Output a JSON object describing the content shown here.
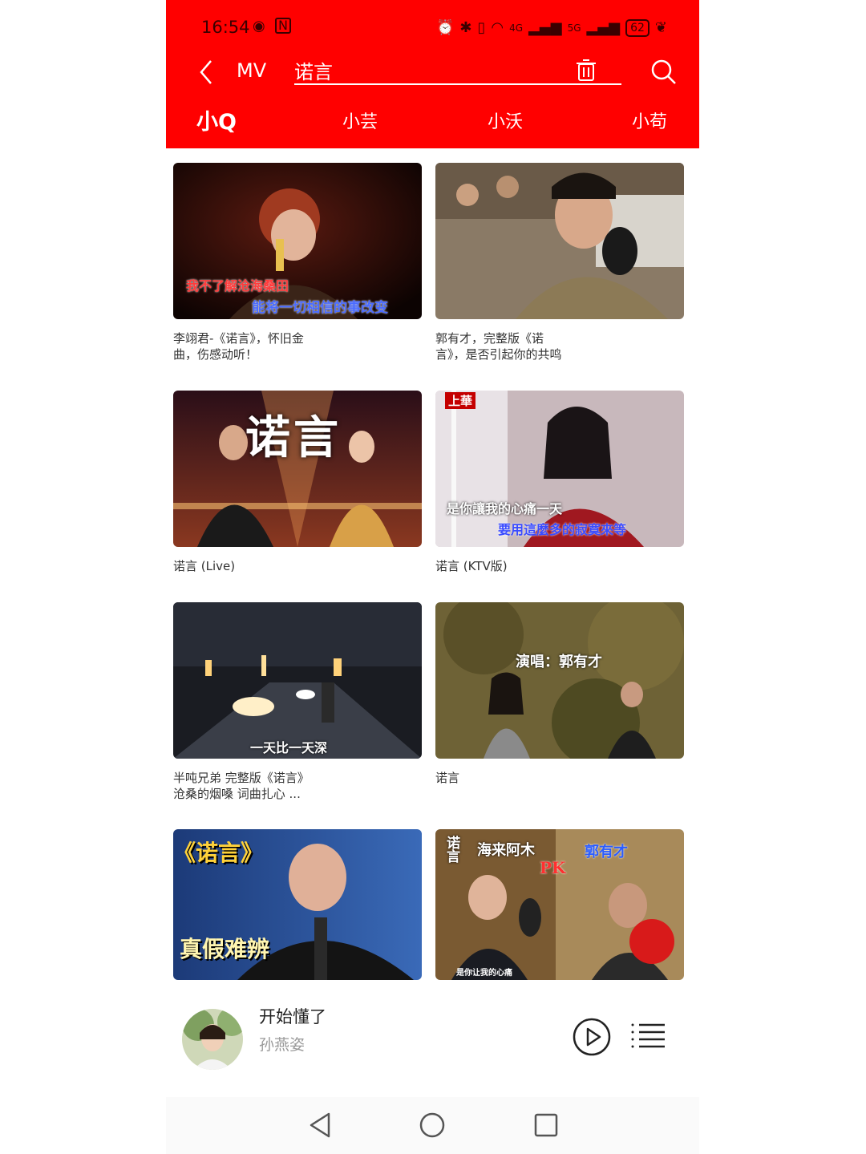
{
  "status": {
    "time": "16:54",
    "battery": "62",
    "net1": "4G",
    "net2": "5G"
  },
  "toolbar": {
    "section": "MV",
    "query": "诺言"
  },
  "tabs": [
    {
      "label": "小Q",
      "active": true
    },
    {
      "label": "小芸",
      "active": false
    },
    {
      "label": "小沃",
      "active": false
    },
    {
      "label": "小苟",
      "active": false
    }
  ],
  "videos": [
    {
      "title": "李翊君-《诺言》，怀旧金\n曲，伤感动听！",
      "lyric1": "我不了解沧海桑田",
      "lyric2": "能将一切相信的事改变"
    },
    {
      "title": "郭有才，完整版《诺\n言》，是否引起你的共鸣"
    },
    {
      "title": "诺言 (Live)",
      "overlay": "诺言"
    },
    {
      "title": "诺言 (KTV版)",
      "badge": "上華",
      "lyric1": "是你讓我的心痛一天",
      "lyric2": "要用這麼多的寂寞來等"
    },
    {
      "title": "半吨兄弟  完整版《诺言》\n沧桑的烟嗓  词曲扎心  ...",
      "lyric1": "一天比一天深"
    },
    {
      "title": "诺言",
      "lyric1": "演唱：郭有才"
    },
    {
      "title": "",
      "overlay": "《诺言》",
      "overlay2": "真假难辨"
    },
    {
      "title": "",
      "overlay": "诺言",
      "name1": "海来阿木",
      "pk": "PK",
      "name2": "郭有才",
      "lyric1": "是你让我的心痛"
    }
  ],
  "player": {
    "song": "开始懂了",
    "artist": "孙燕姿"
  },
  "colors": {
    "brand": "#ff0000",
    "header_text": "#ffffff"
  }
}
